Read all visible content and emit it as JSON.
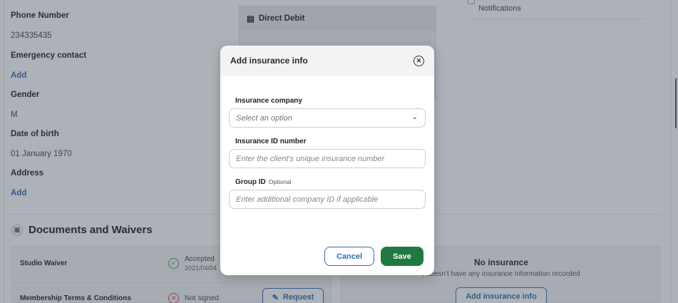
{
  "profile": {
    "phone_label": "Phone Number",
    "phone_value": "234335435",
    "emergency_label": "Emergency contact",
    "emergency_action": "Add",
    "gender_label": "Gender",
    "gender_value": "M",
    "dob_label": "Date of birth",
    "dob_value": "01 January 1970",
    "address_label": "Address",
    "address_action": "Add"
  },
  "payment": {
    "method_label": "Direct Debit"
  },
  "notifications": {
    "label": "Notifications"
  },
  "documents": {
    "title": "Documents and Waivers",
    "rows": [
      {
        "name": "Studio Waiver",
        "status": "Accepted",
        "date": "2021/04/04"
      },
      {
        "name": "Membership Terms & Conditions",
        "status": "Not signed",
        "action": "Request"
      }
    ]
  },
  "insurance": {
    "title": "No insurance",
    "subtitle": "t doesn't have any insurance information recorded",
    "add_button": "Add insurance info"
  },
  "modal": {
    "title": "Add insurance info",
    "company_label": "Insurance company",
    "company_placeholder": "Select an option",
    "id_label": "Insurance ID number",
    "id_placeholder": "Enter the client's unique insurance number",
    "group_label": "Group ID",
    "group_optional": "Optional",
    "group_placeholder": "Enter additional company ID if applicable",
    "cancel_label": "Cancel",
    "save_label": "Save"
  },
  "colors": {
    "link_blue": "#2f6fb5",
    "save_green": "#1f7a3f",
    "accepted_green": "#3aa05a",
    "not_signed_red": "#d64545"
  }
}
